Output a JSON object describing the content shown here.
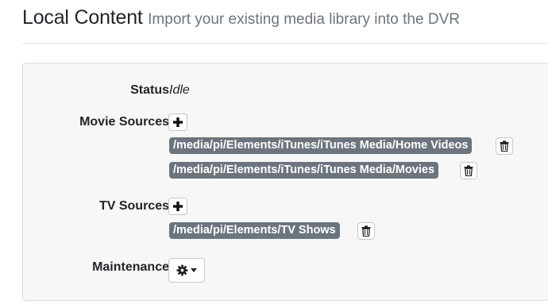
{
  "header": {
    "title": "Local Content",
    "subtitle": "Import your existing media library into the DVR"
  },
  "panel": {
    "status": {
      "label": "Status",
      "value": "Idle"
    },
    "movie_sources": {
      "label": "Movie Sources",
      "add_icon": "plus-icon",
      "paths": [
        "/media/pi/Elements/iTunes/iTunes Media/Home Videos",
        "/media/pi/Elements/iTunes/iTunes Media/Movies"
      ],
      "remove_icon": "trash-icon"
    },
    "tv_sources": {
      "label": "TV Sources",
      "add_icon": "plus-icon",
      "paths": [
        "/media/pi/Elements/TV Shows"
      ],
      "remove_icon": "trash-icon"
    },
    "maintenance": {
      "label": "Maintenance",
      "menu_icon": "gear-icon",
      "caret_icon": "caret-down-icon"
    }
  },
  "colors": {
    "path_badge": "#6c757d",
    "panel_bg": "#f7f7f7",
    "subtitle": "#6c757d"
  }
}
